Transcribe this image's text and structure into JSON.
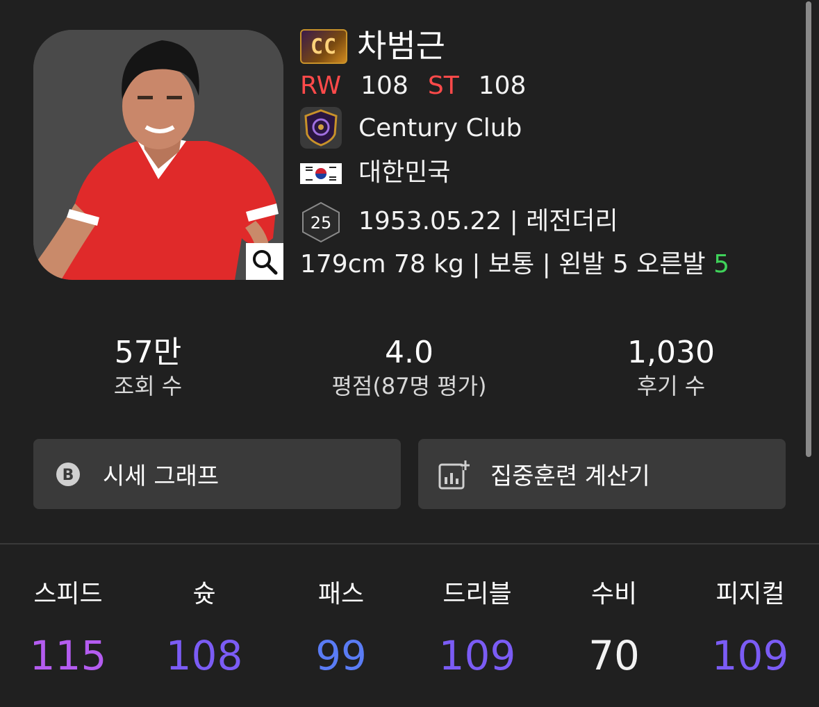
{
  "player": {
    "badge": "CC",
    "name": "차범근",
    "positions": [
      {
        "pos": "RW",
        "ovr": "108"
      },
      {
        "pos": "ST",
        "ovr": "108"
      }
    ],
    "club": "Century Club",
    "nation": "대한민국",
    "level_badge": "25",
    "birth_line": "1953.05.22 | 레전더리",
    "physical_prefix": "179cm 78 kg | 보통 | 왼발 5 오른발 ",
    "right_foot": "5"
  },
  "stats": [
    {
      "value": "57만",
      "label": "조회 수"
    },
    {
      "value": "4.0",
      "label": "평점(87명 평가)"
    },
    {
      "value": "1,030",
      "label": "후기 수"
    }
  ],
  "buttons": {
    "price_graph": "시세 그래프",
    "training_calc": "집중훈련 계산기"
  },
  "attributes": [
    {
      "name": "스피드",
      "value": "115",
      "color": "#b45cf0"
    },
    {
      "name": "슛",
      "value": "108",
      "color": "#7b5cf5"
    },
    {
      "name": "패스",
      "value": "99",
      "color": "#5a7cf5"
    },
    {
      "name": "드리블",
      "value": "109",
      "color": "#7b5cf5"
    },
    {
      "name": "수비",
      "value": "70",
      "color": "#f2f2f2"
    },
    {
      "name": "피지컬",
      "value": "109",
      "color": "#7b5cf5"
    }
  ],
  "colors": {
    "background": "#202020",
    "position": "#ff4a4a",
    "green": "#3fd25a",
    "button_bg": "#3a3a3a"
  },
  "icons": [
    "zoom-icon",
    "club-emblem-icon",
    "korea-flag-icon",
    "level-hex-icon",
    "currency-icon",
    "chart-add-icon"
  ]
}
